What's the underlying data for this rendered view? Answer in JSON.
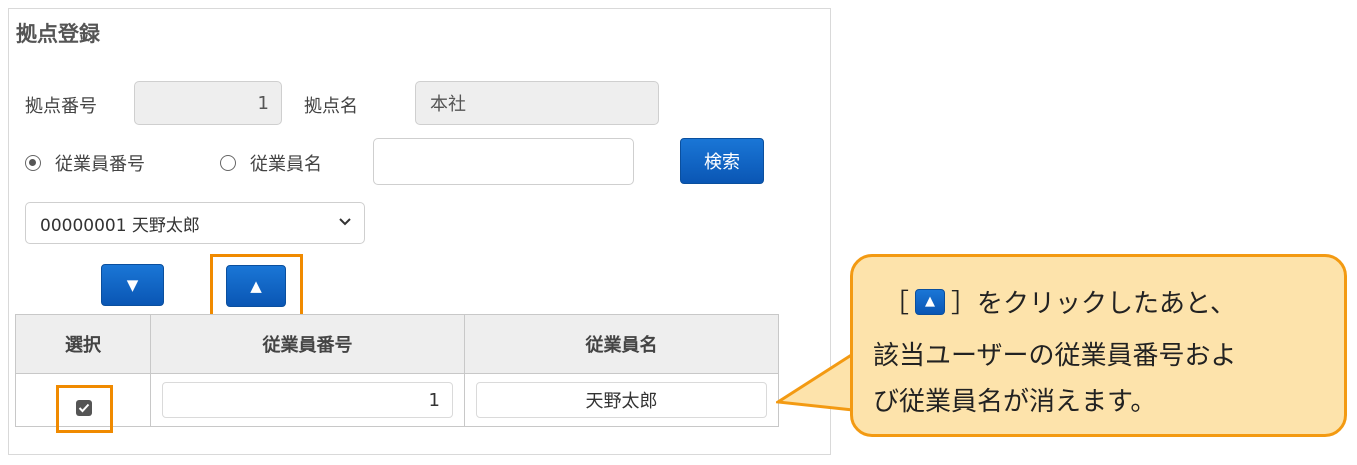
{
  "panel": {
    "title": "拠点登録",
    "base_number_label": "拠点番号",
    "base_number_value": "1",
    "base_name_label": "拠点名",
    "base_name_value": "本社"
  },
  "search": {
    "radio_employee_number": "従業員番号",
    "radio_employee_name": "従業員名",
    "selected_radio": "従業員番号",
    "input_value": "",
    "button_label": "検索"
  },
  "select": {
    "selected": "00000001 天野太郎"
  },
  "buttons": {
    "down_glyph": "▼",
    "up_glyph": "▲"
  },
  "table": {
    "headers": [
      "選択",
      "従業員番号",
      "従業員名"
    ],
    "rows": [
      {
        "selected": true,
        "employee_number": "1",
        "employee_name": "天野太郎"
      }
    ]
  },
  "callout": {
    "bracket_open": "［",
    "bracket_close": "］をクリックしたあと、",
    "line2": "該当ユーザーの従業員番号およ",
    "line3": "び従業員名が消えます。",
    "button_glyph": "▲"
  },
  "colors": {
    "accent_blue": "#0a62c4",
    "highlight_orange": "#f08a00",
    "callout_fill": "#fde3ab"
  }
}
